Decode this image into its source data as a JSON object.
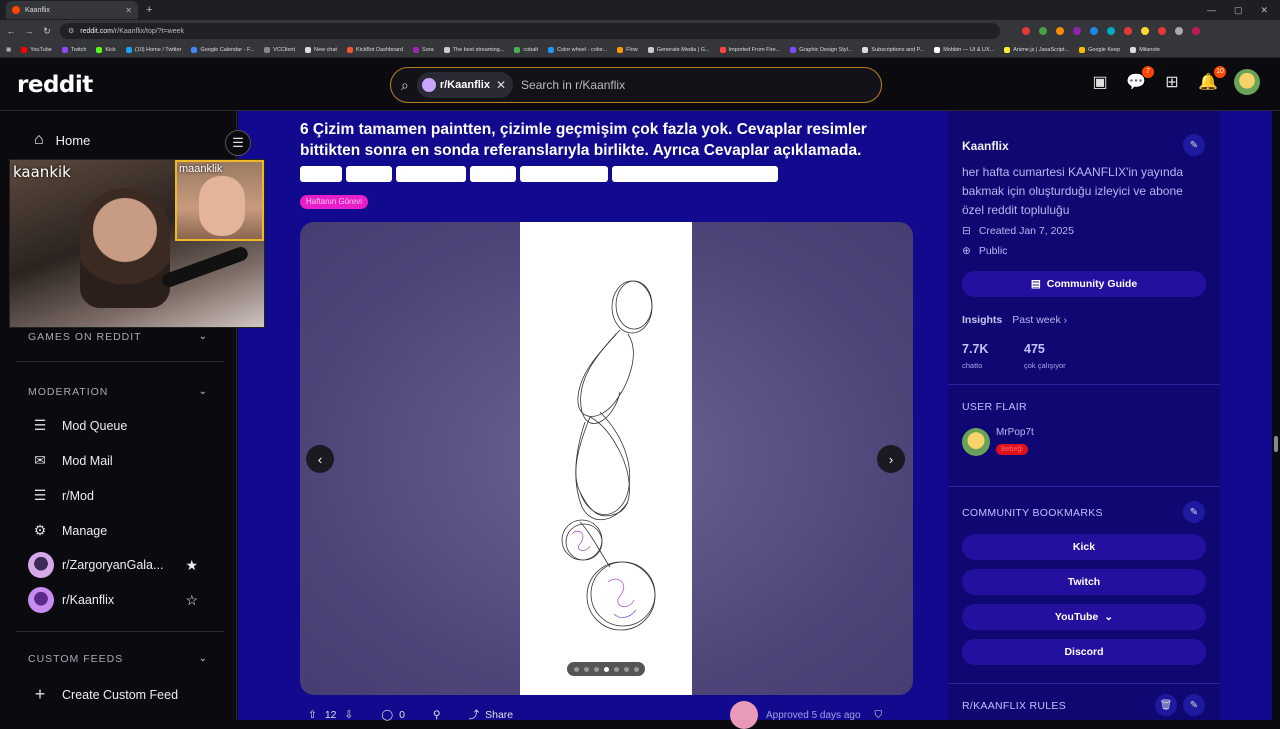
{
  "browser": {
    "tab_title": "Kaanflix",
    "url_host": "reddit.com",
    "url_path": "/r/Kaanflix/top/?t=week",
    "bookmarks": [
      "YouTube",
      "Twitch",
      "Kick",
      "(10) Home / Twitter",
      "Google Calendar - F...",
      "VCClient",
      "New chat",
      "KickBot Dashboard",
      "Sora",
      "The best streaming...",
      "cobalt",
      "Color wheel - color...",
      "Flow",
      "Generate Media | G...",
      "Imported From Fire...",
      "Graphic Design Styl...",
      "Subscriptions and P...",
      "Mobbin — UI & UX...",
      "Anime.js | JavaScript...",
      "Google Keep",
      "Milanote"
    ]
  },
  "header": {
    "logo": "reddit",
    "search_chip": "r/Kaanflix",
    "search_placeholder": "Search in r/Kaanflix",
    "chat_badge": "7",
    "notif_badge": "10"
  },
  "sidebar": {
    "home": "Home",
    "games_heading": "GAMES ON REDDIT",
    "moderation_heading": "MODERATION",
    "mod_items": [
      "Mod Queue",
      "Mod Mail",
      "r/Mod",
      "Manage"
    ],
    "communities": [
      "r/ZargoryanGala...",
      "r/Kaanflix"
    ],
    "custom_feeds_heading": "CUSTOM FEEDS",
    "create_feed": "Create Custom Feed"
  },
  "webcam": {
    "main_name": "kaankik",
    "guest_name": "maanklik"
  },
  "post": {
    "title": "6 Çizim tamamen paintten, çizimle geçmişim çok fazla yok. Cevaplar resimler bittikten sonra en sonda referanslarıyla birlikte. Ayrıca Cevaplar açıklamada.",
    "flair": "Haftanın Görevi",
    "gallery_count": 7,
    "gallery_active": 4,
    "upvotes": "12",
    "comments": "0",
    "share": "Share",
    "approved": "Approved 5 days ago"
  },
  "community": {
    "name": "Kaanflix",
    "description": "her hafta cumartesi KAANFLIX'in yayında bakmak için oluşturduğu izleyici ve abone özel reddit topluluğu",
    "created": "Created Jan 7, 2025",
    "visibility": "Public",
    "guide_button": "Community Guide",
    "insights_label": "Insights",
    "insights_period": "Past week",
    "stat1_value": "7.7K",
    "stat1_label": "chatto",
    "stat2_value": "475",
    "stat2_label": "çok çalışıyor",
    "user_flair_heading": "USER FLAIR",
    "user_name": "MrPop7t",
    "user_flair": "Bebeği",
    "bookmarks_heading": "COMMUNITY BOOKMARKS",
    "bookmarks": [
      "Kick",
      "Twitch",
      "YouTube",
      "Discord"
    ],
    "rules_heading": "R/KAANFLIX RULES"
  }
}
